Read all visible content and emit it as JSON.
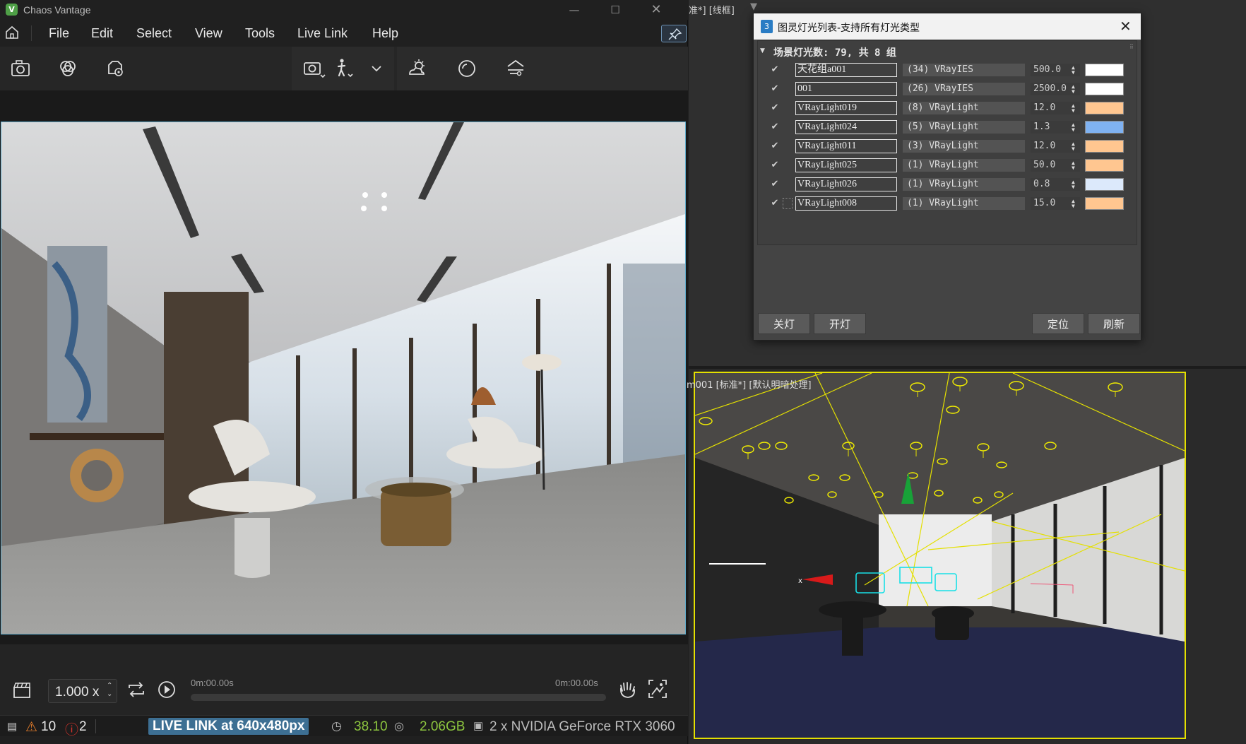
{
  "vantage": {
    "title": "Chaos Vantage",
    "menu": [
      "File",
      "Edit",
      "Select",
      "View",
      "Tools",
      "Live Link",
      "Help"
    ],
    "timeline": {
      "speed": "1.000 x",
      "time_start": "0m:00.00s",
      "time_end": "0m:00.00s"
    },
    "status": {
      "warnings": "10",
      "errors": "2",
      "live_link": "LIVE LINK at 640x480px",
      "fps": "38.10",
      "memory": "2.06GB",
      "gpu": "2 x NVIDIA GeForce RTX 3060"
    }
  },
  "max": {
    "top_viewport_label": "准*] [线框]",
    "bottom_viewport_label": "m001 [标准*] [默认明暗处理]"
  },
  "light_dialog": {
    "title": "图灵灯光列表-支持所有灯光类型",
    "group_header": "场景灯光数: 79, 共 8 组",
    "lights": [
      {
        "name": "天花组a001",
        "type": "(34) VRayIES",
        "value": "500.0",
        "color": "#ffffff",
        "checked": true
      },
      {
        "name": "001",
        "type": "(26) VRayIES",
        "value": "2500.0",
        "color": "#ffffff",
        "checked": true
      },
      {
        "name": "VRayLight019",
        "type": "(8) VRayLight",
        "value": "12.0",
        "color": "#ffc690",
        "checked": true
      },
      {
        "name": "VRayLight024",
        "type": "(5) VRayLight",
        "value": "1.3",
        "color": "#7fb2f2",
        "checked": true
      },
      {
        "name": "VRayLight011",
        "type": "(3) VRayLight",
        "value": "12.0",
        "color": "#ffc690",
        "checked": true
      },
      {
        "name": "VRayLight025",
        "type": "(1) VRayLight",
        "value": "50.0",
        "color": "#ffc690",
        "checked": true
      },
      {
        "name": "VRayLight026",
        "type": "(1) VRayLight",
        "value": "0.8",
        "color": "#dce9fb",
        "checked": true
      },
      {
        "name": "VRayLight008",
        "type": "(1) VRayLight",
        "value": "15.0",
        "color": "#ffc690",
        "checked": true
      }
    ],
    "buttons": {
      "lights_off": "关灯",
      "lights_on": "开灯",
      "locate": "定位",
      "refresh": "刷新"
    }
  },
  "colors": {
    "accent": "#5fa9c8",
    "live_badge": "#3d6f93",
    "fps_green": "#8dc63f",
    "warning": "#e07b2a",
    "error": "#d9342b",
    "wire_yellow": "#e4e000"
  }
}
